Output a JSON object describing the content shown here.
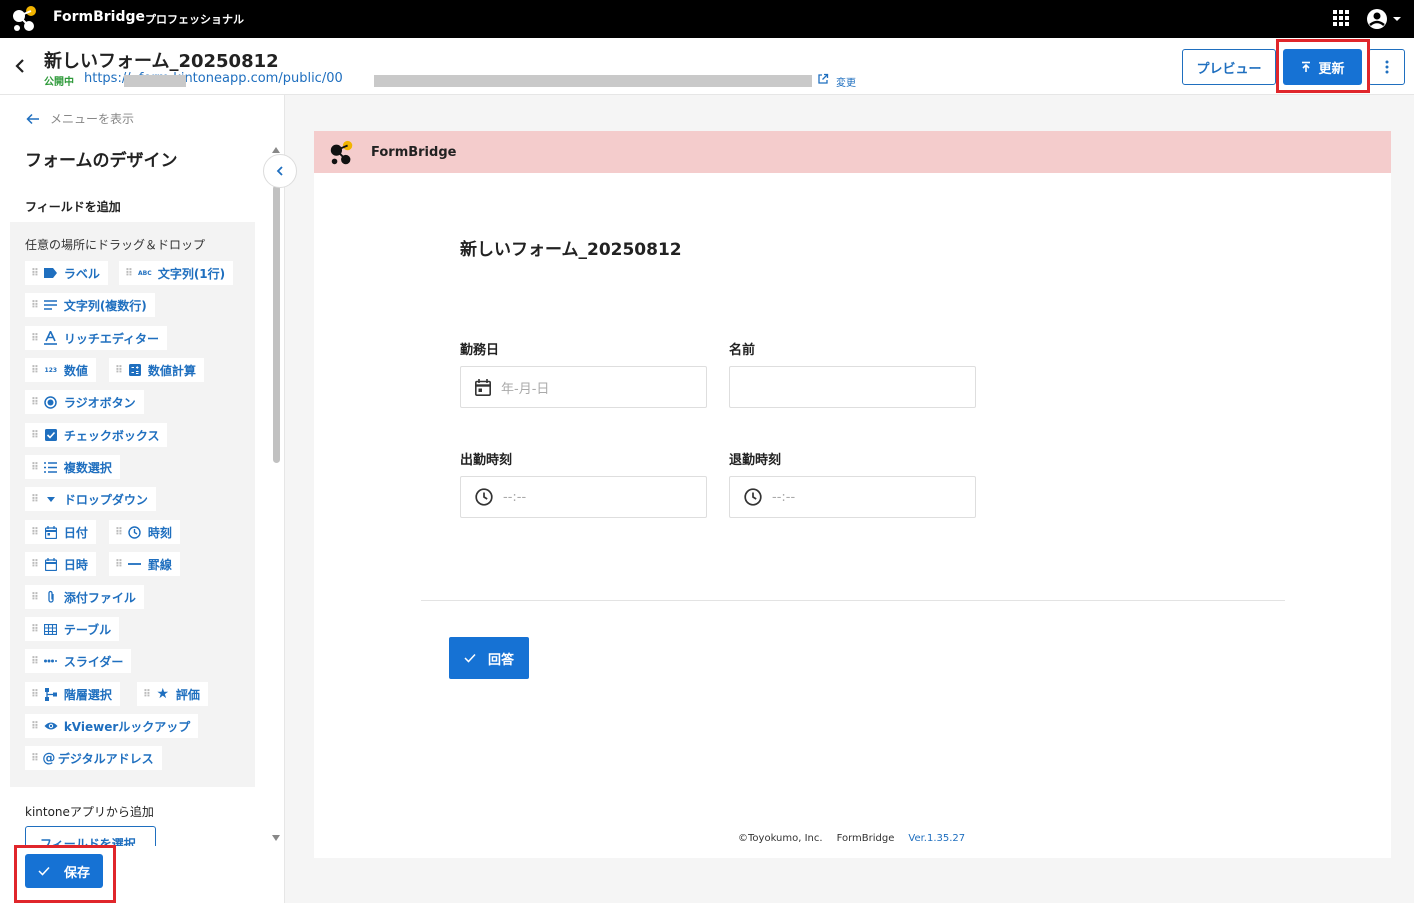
{
  "topbar": {
    "brand": "FormBridge",
    "plan": "プロフェッショナル"
  },
  "header": {
    "title": "新しいフォーム_20250812",
    "status": "公開中",
    "url": "https://        .form.kintoneapp.com/public/00",
    "change_label": "変更",
    "preview_label": "プレビュー",
    "update_label": "更新"
  },
  "sidebar": {
    "menu_label": "メニューを表示",
    "title": "フォームのデザイン",
    "add_field_label": "フィールドを追加",
    "drag_hint": "任意の場所にドラッグ＆ドロップ",
    "fields": [
      {
        "label": "ラベル",
        "icon": "label-icon"
      },
      {
        "label": "文字列(1行)",
        "icon": "abc-icon"
      },
      {
        "label": "文字列(複数行)",
        "icon": "multiline-icon"
      },
      {
        "label": "リッチエディター",
        "icon": "text-format-icon"
      },
      {
        "label": "数値",
        "icon": "number-icon"
      },
      {
        "label": "数値計算",
        "icon": "calculator-icon"
      },
      {
        "label": "ラジオボタン",
        "icon": "radio-icon"
      },
      {
        "label": "チェックボックス",
        "icon": "checkbox-icon"
      },
      {
        "label": "複数選択",
        "icon": "list-icon"
      },
      {
        "label": "ドロップダウン",
        "icon": "dropdown-icon"
      },
      {
        "label": "日付",
        "icon": "calendar-icon"
      },
      {
        "label": "時刻",
        "icon": "clock-icon"
      },
      {
        "label": "日時",
        "icon": "datetime-icon"
      },
      {
        "label": "罫線",
        "icon": "line-icon"
      },
      {
        "label": "添付ファイル",
        "icon": "paperclip-icon"
      },
      {
        "label": "テーブル",
        "icon": "table-icon"
      },
      {
        "label": "スライダー",
        "icon": "slider-icon"
      },
      {
        "label": "階層選択",
        "icon": "hierarchy-icon"
      },
      {
        "label": "評価",
        "icon": "star-icon"
      },
      {
        "label": "kViewerルックアップ",
        "icon": "eye-icon"
      },
      {
        "label": "デジタルアドレス",
        "icon": "at-icon"
      }
    ],
    "kintone_label": "kintoneアプリから追加",
    "select_field_label": "フィールドを選択",
    "save_label": "保存"
  },
  "form": {
    "brand": "FormBridge",
    "heading": "新しいフォーム_20250812",
    "fields": [
      {
        "label": "勤務日",
        "placeholder": "年-月-日"
      },
      {
        "label": "名前",
        "placeholder": ""
      },
      {
        "label": "出勤時刻",
        "placeholder": "--:--"
      },
      {
        "label": "退勤時刻",
        "placeholder": "--:--"
      }
    ],
    "submit_label": "回答",
    "footer": {
      "copyright": "©Toyokumo, Inc.",
      "product": "FormBridge",
      "version": "Ver.1.35.27"
    }
  },
  "colors": {
    "primary": "#1672d4",
    "highlight": "#e0262b",
    "form_header": "#f4cccc",
    "status_green": "#2e9a3a"
  }
}
